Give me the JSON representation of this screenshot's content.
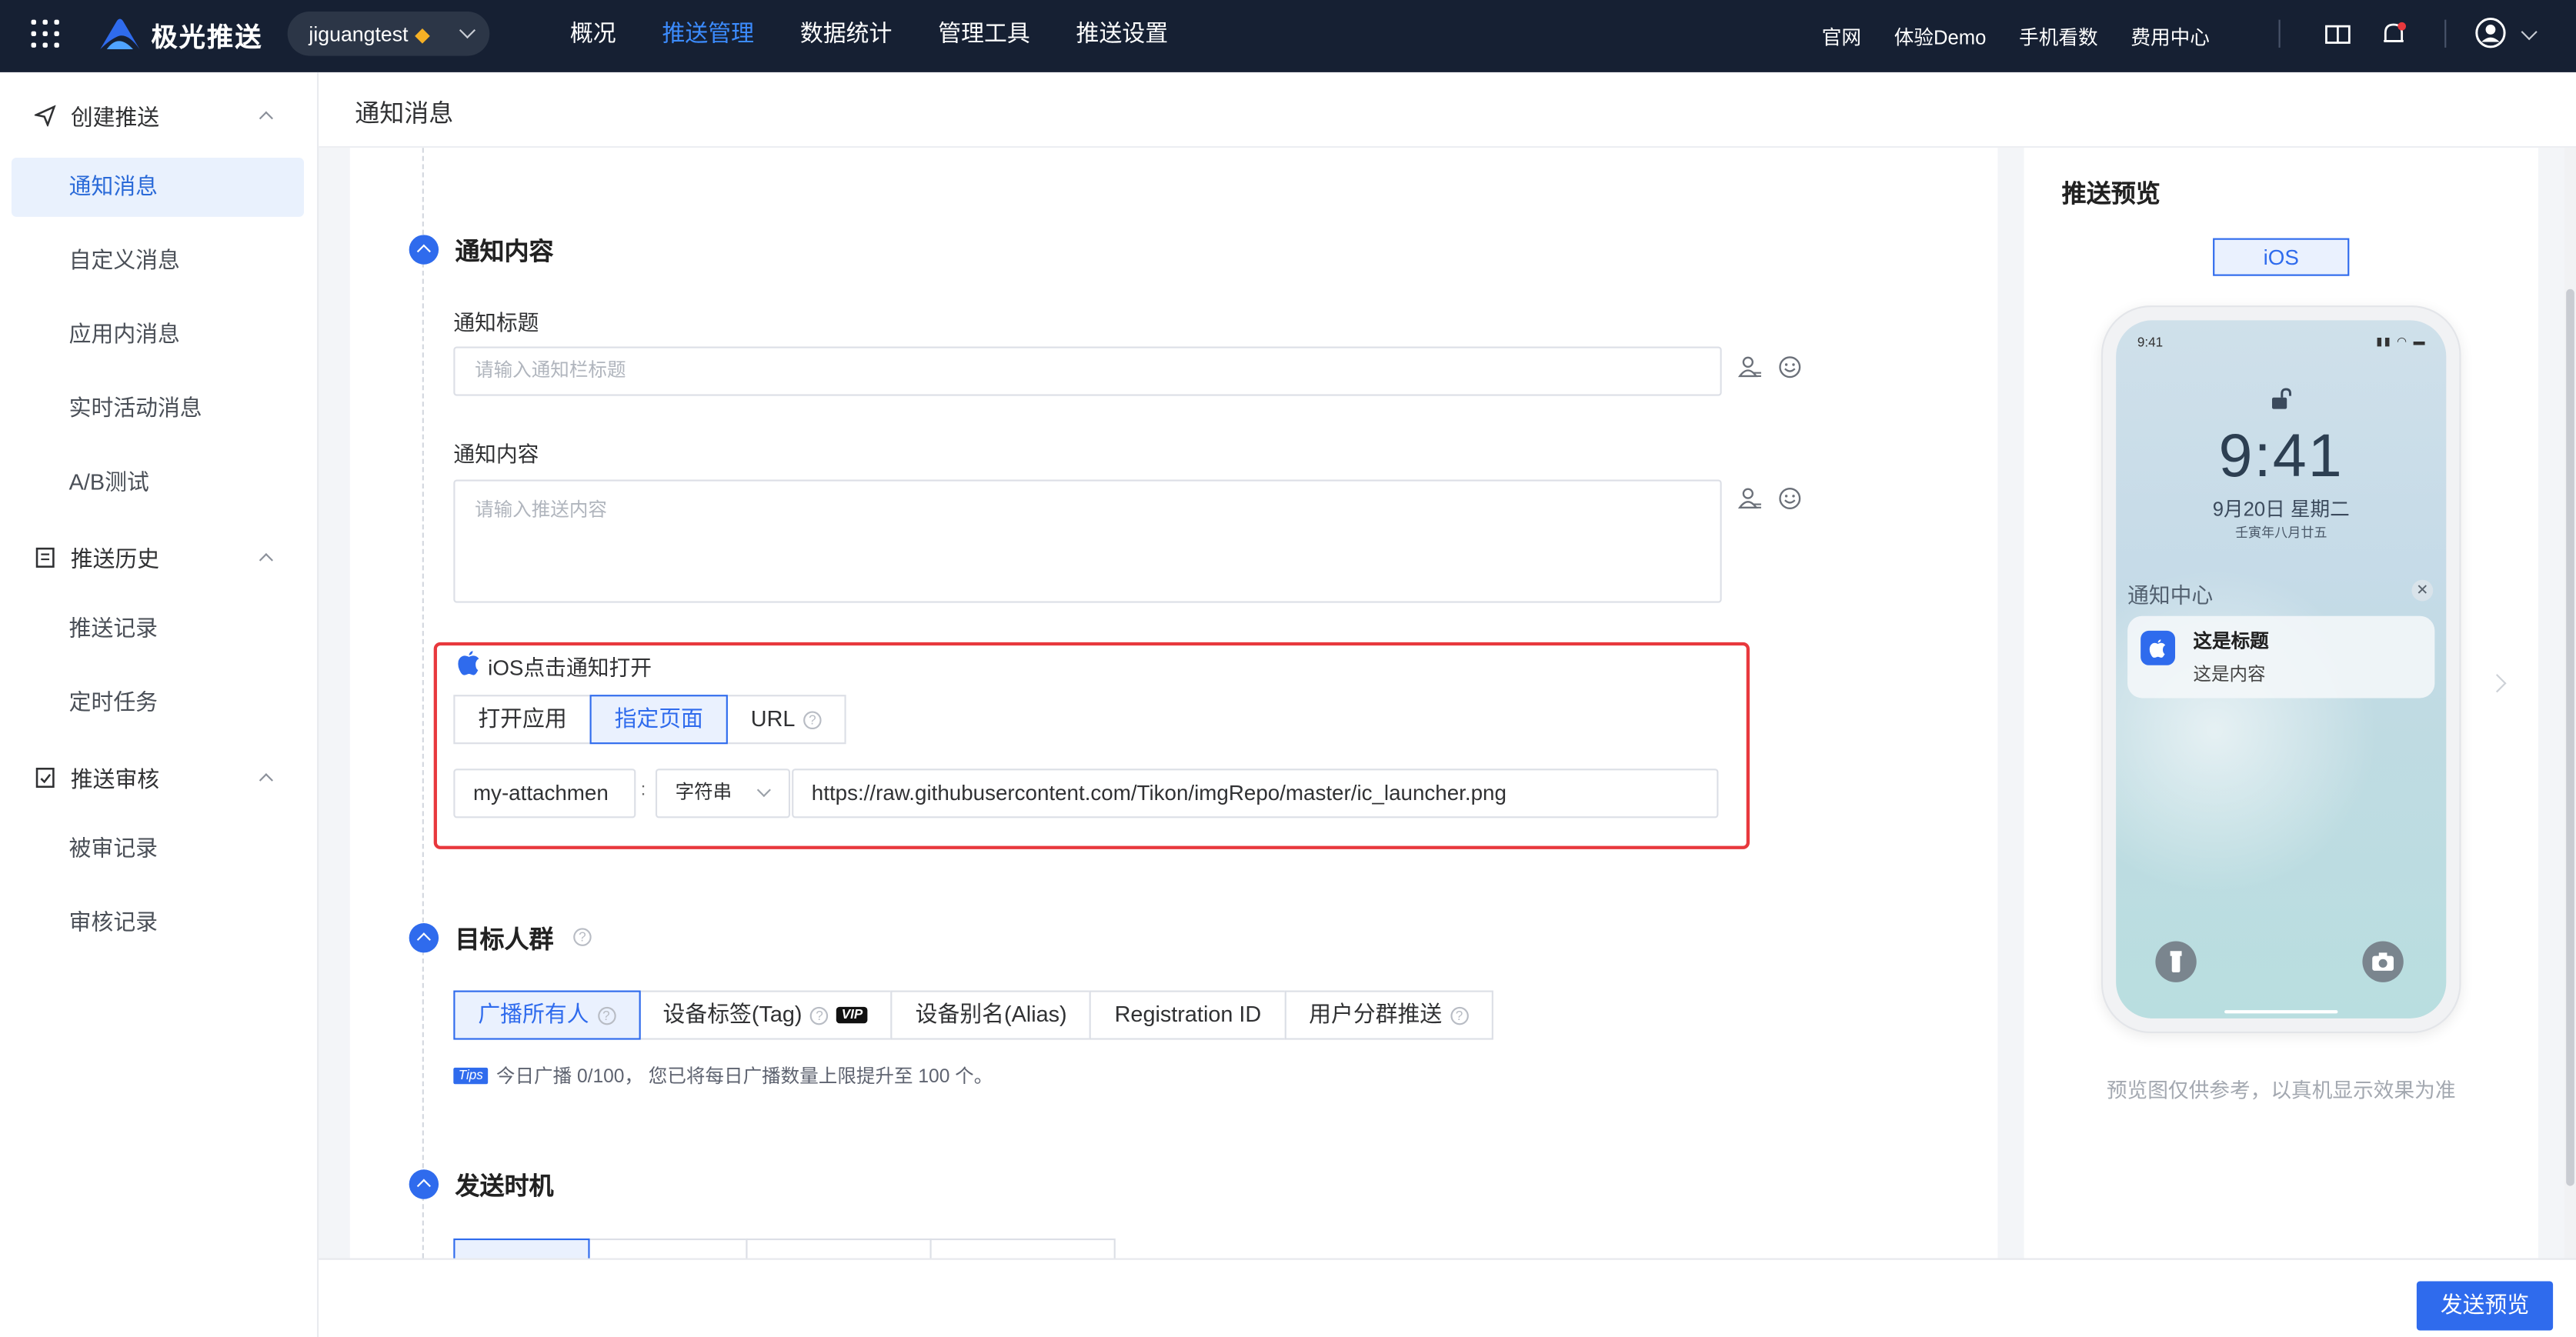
{
  "topbar": {
    "logo_text": "极光推送",
    "app_name": "jiguangtest",
    "nav": [
      "概况",
      "推送管理",
      "数据统计",
      "管理工具",
      "推送设置"
    ],
    "nav_active": "推送管理",
    "links": [
      "官网",
      "体验Demo",
      "手机看数",
      "费用中心"
    ]
  },
  "sidebar": {
    "sections": [
      {
        "label": "创建推送",
        "items": [
          "通知消息",
          "自定义消息",
          "应用内消息",
          "实时活动消息",
          "A/B测试"
        ]
      },
      {
        "label": "推送历史",
        "items": [
          "推送记录",
          "定时任务"
        ]
      },
      {
        "label": "推送审核",
        "items": [
          "被审记录",
          "审核记录"
        ]
      }
    ],
    "active_item": "通知消息"
  },
  "page": {
    "title": "通知消息"
  },
  "content": {
    "section_title": "通知内容",
    "title_label": "通知标题",
    "title_placeholder": "请输入通知栏标题",
    "body_label": "通知内容",
    "body_placeholder": "请输入推送内容",
    "ios_open": {
      "label": "iOS点击通知打开",
      "options": [
        "打开应用",
        "指定页面",
        "URL"
      ],
      "selected": "指定页面",
      "key_value": "my-attachmen",
      "separator": ":",
      "type_value": "字符串",
      "url_value": "https://raw.githubusercontent.com/Tikon/imgRepo/master/ic_launcher.png"
    }
  },
  "target": {
    "title": "目标人群",
    "options": [
      "广播所有人",
      "设备标签(Tag)",
      "设备别名(Alias)",
      "Registration ID",
      "用户分群推送"
    ],
    "selected": "广播所有人",
    "vip_badge": "VIP",
    "tips_tag": "Tips",
    "tips_text": "今日广播 0/100， 您已将每日广播数量上限提升至 100 个。"
  },
  "timing": {
    "title": "发送时机"
  },
  "preview": {
    "title": "推送预览",
    "platform": "iOS",
    "status_time": "9:41",
    "big_time": "9:41",
    "date": "9月20日 星期二",
    "lunar": "壬寅年八月廿五",
    "notification_center": "通知中心",
    "notif_title": "这是标题",
    "notif_body": "这是内容",
    "note": "预览图仅供参考，以真机显示效果为准"
  },
  "footer": {
    "preview_button": "发送预览"
  },
  "colors": {
    "brand": "#2f6bed",
    "topbar": "#162033",
    "highlight_border": "#e8383d"
  }
}
